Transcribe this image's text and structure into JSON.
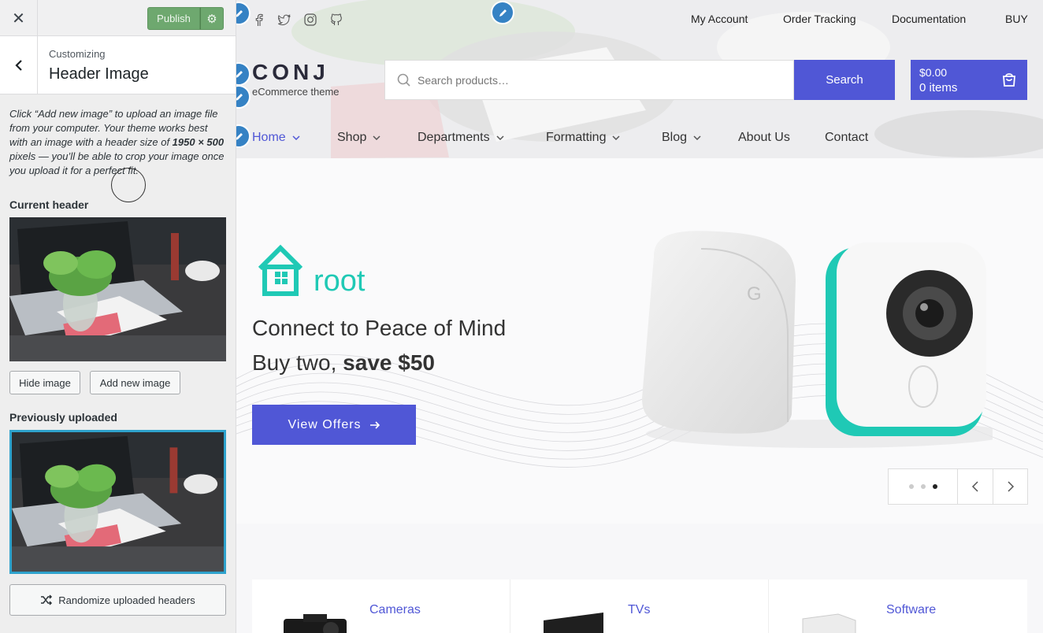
{
  "customizer": {
    "close_label": "✕",
    "publish_label": "Publish",
    "customizing_label": "Customizing",
    "section_title": "Header Image",
    "description_part1": "Click “Add new image” to upload an image file from your computer. Your theme works best with an image with a header size of ",
    "description_size": "1950 × 500",
    "description_part2": " pixels — you’ll be able to crop your image once you upload it for a perfect fit.",
    "current_header_label": "Current header",
    "hide_image_label": "Hide image",
    "add_new_image_label": "Add new image",
    "previously_uploaded_label": "Previously uploaded",
    "randomize_label": "Randomize uploaded headers"
  },
  "site": {
    "top_links": [
      "My Account",
      "Order Tracking",
      "Documentation",
      "BUY"
    ],
    "logo_text": "CONJ",
    "logo_subtitle": "eCommerce theme",
    "search_placeholder": "Search products…",
    "search_button": "Search",
    "cart_total": "$0.00",
    "cart_items": "0 items",
    "nav": [
      "Home",
      "Shop",
      "Departments",
      "Formatting",
      "Blog",
      "About Us",
      "Contact"
    ],
    "slide": {
      "brand": "root",
      "headline": "Connect to Peace of Mind",
      "sub_prefix": "Buy two,",
      "sub_bold": "save $50",
      "cta": "View Offers",
      "active_dot": 3,
      "dot_count": 3
    },
    "categories": [
      "Cameras",
      "TVs",
      "Software"
    ]
  },
  "colors": {
    "accent": "#5057d6",
    "publish_green": "#6ea86f",
    "edit_blue": "#3582c4",
    "teal": "#1fc9b5",
    "selected_border": "#2ea2cc"
  },
  "icons": [
    "close-icon",
    "gear-icon",
    "back-chevron-icon",
    "facebook-icon",
    "twitter-icon",
    "instagram-icon",
    "github-icon",
    "search-icon",
    "cart-icon",
    "chevron-down-icon",
    "arrow-right-icon",
    "shuffle-icon",
    "pencil-icon"
  ]
}
